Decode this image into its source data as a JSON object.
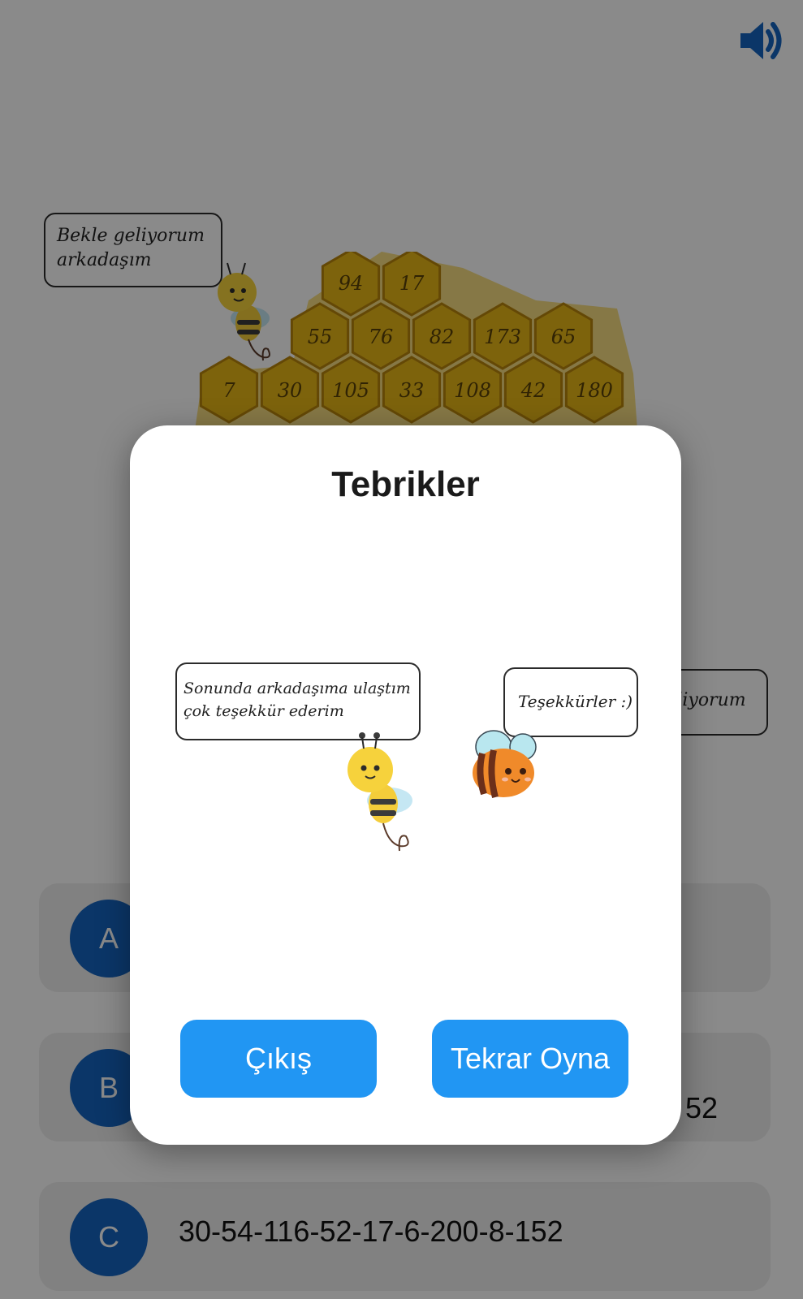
{
  "header": {
    "sound_icon": "speaker-volume-icon"
  },
  "game": {
    "bubble_left": {
      "line1": "Bekle geliyorum",
      "line2": "arkadaşım"
    },
    "bubble_right_partial": "kliyorum",
    "hive_rows": [
      [
        "94",
        "17"
      ],
      [
        "55",
        "76",
        "82",
        "173",
        "65"
      ],
      [
        "7",
        "30",
        "105",
        "33",
        "108",
        "42",
        "180"
      ]
    ],
    "options": [
      {
        "letter": "A",
        "text": ""
      },
      {
        "letter": "B",
        "text": "52"
      },
      {
        "letter": "C",
        "text": "30-54-116-52-17-6-200-8-152"
      }
    ]
  },
  "dialog": {
    "title": "Tebrikler",
    "bee_speech": {
      "line1": "Sonunda arkadaşıma ulaştım",
      "line2": "çok teşekkür ederim"
    },
    "friend_speech": "Teşekkürler :)",
    "exit_label": "Çıkış",
    "replay_label": "Tekrar Oyna"
  },
  "colors": {
    "accent_button": "#2196f3",
    "option_circle": "#1565c0",
    "honey": "#f2c21a"
  }
}
